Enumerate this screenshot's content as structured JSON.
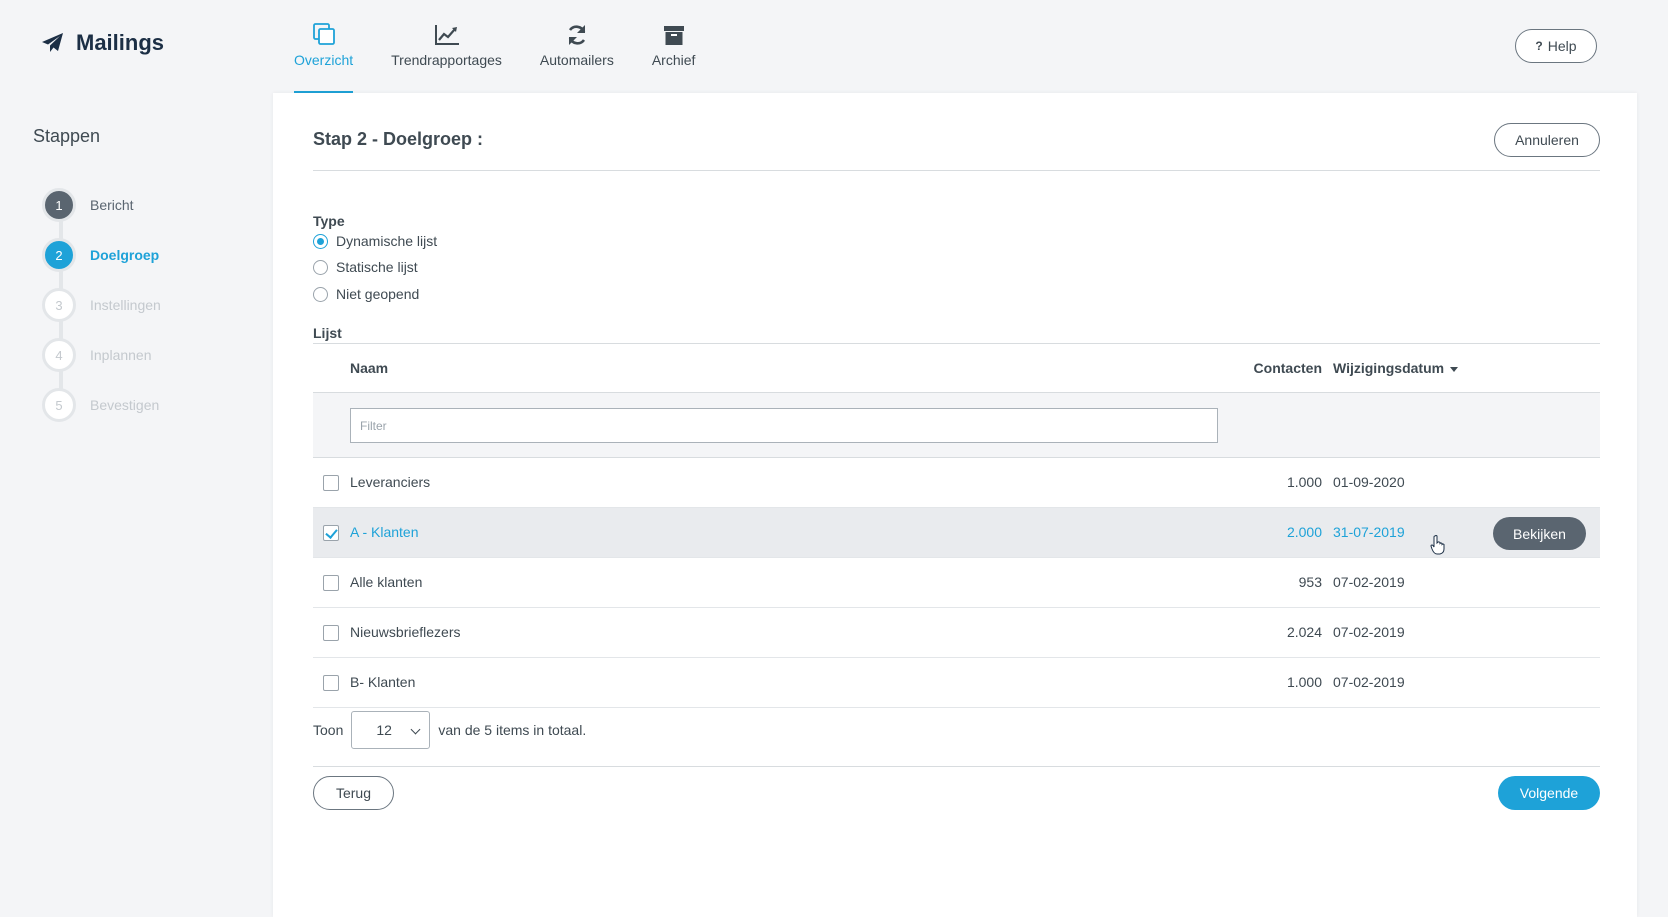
{
  "app": {
    "title": "Mailings"
  },
  "nav": [
    {
      "label": "Overzicht",
      "icon": "overview-icon",
      "active": true
    },
    {
      "label": "Trendrapportages",
      "icon": "trend-chart-icon",
      "active": false
    },
    {
      "label": "Automailers",
      "icon": "refresh-icon",
      "active": false
    },
    {
      "label": "Archief",
      "icon": "archive-icon",
      "active": false
    }
  ],
  "header": {
    "help_label": "Help"
  },
  "sidebar": {
    "title": "Stappen",
    "steps": [
      {
        "number": "1",
        "label": "Bericht",
        "state": "done"
      },
      {
        "number": "2",
        "label": "Doelgroep",
        "state": "current"
      },
      {
        "number": "3",
        "label": "Instellingen",
        "state": "pending"
      },
      {
        "number": "4",
        "label": "Inplannen",
        "state": "pending"
      },
      {
        "number": "5",
        "label": "Bevestigen",
        "state": "pending"
      }
    ]
  },
  "main": {
    "title": "Stap 2 - Doelgroep :",
    "cancel_label": "Annuleren",
    "type_label": "Type",
    "type_options": [
      {
        "label": "Dynamische lijst",
        "selected": true
      },
      {
        "label": "Statische lijst",
        "selected": false
      },
      {
        "label": "Niet geopend",
        "selected": false
      }
    ],
    "list_label": "Lijst",
    "table": {
      "columns": {
        "name": "Naam",
        "contacts": "Contacten",
        "date": "Wijzigingsdatum"
      },
      "filter_placeholder": "Filter",
      "rows": [
        {
          "name": "Leveranciers",
          "contacts": "1.000",
          "date": "01-09-2020",
          "checked": false
        },
        {
          "name": "A - Klanten",
          "contacts": "2.000",
          "date": "31-07-2019",
          "checked": true,
          "action": "Bekijken"
        },
        {
          "name": "Alle klanten",
          "contacts": "953",
          "date": "07-02-2019",
          "checked": false
        },
        {
          "name": "Nieuwsbrieflezers",
          "contacts": "2.024",
          "date": "07-02-2019",
          "checked": false
        },
        {
          "name": "B- Klanten",
          "contacts": "1.000",
          "date": "07-02-2019",
          "checked": false
        }
      ]
    },
    "pager": {
      "show_label": "Toon",
      "page_size": "12",
      "total_text": "van de 5 items in totaal."
    },
    "back_label": "Terug",
    "next_label": "Volgende"
  },
  "colors": {
    "accent": "#1ea2d8",
    "dark": "#5a6570",
    "navy": "#1c2f45"
  }
}
